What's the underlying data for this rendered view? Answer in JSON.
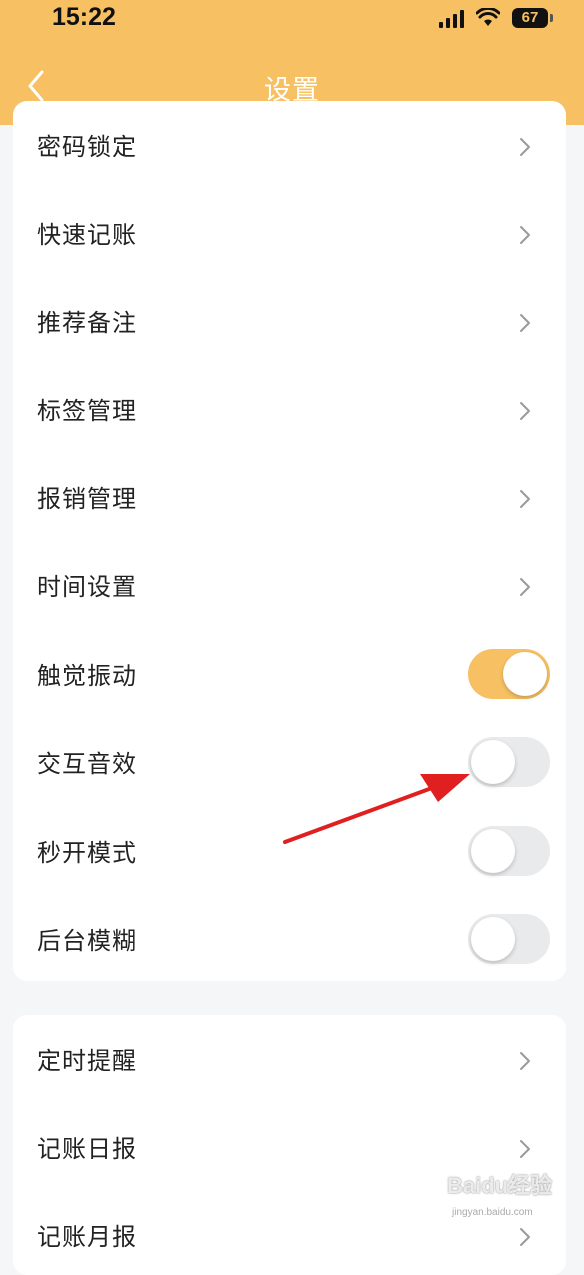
{
  "status_bar": {
    "time": "15:22",
    "battery": "67"
  },
  "header": {
    "title": "设置"
  },
  "group1": [
    {
      "label": "密码锁定",
      "type": "nav"
    },
    {
      "label": "快速记账",
      "type": "nav"
    },
    {
      "label": "推荐备注",
      "type": "nav"
    },
    {
      "label": "标签管理",
      "type": "nav"
    },
    {
      "label": "报销管理",
      "type": "nav"
    },
    {
      "label": "时间设置",
      "type": "nav"
    },
    {
      "label": "触觉振动",
      "type": "toggle",
      "on": true
    },
    {
      "label": "交互音效",
      "type": "toggle",
      "on": false
    },
    {
      "label": "秒开模式",
      "type": "toggle",
      "on": false
    },
    {
      "label": "后台模糊",
      "type": "toggle",
      "on": false
    }
  ],
  "group2": [
    {
      "label": "定时提醒",
      "type": "nav"
    },
    {
      "label": "记账日报",
      "type": "nav"
    },
    {
      "label": "记账月报",
      "type": "nav"
    }
  ],
  "annotation_color": "#e02020",
  "accent_color": "#f7c063",
  "watermark": {
    "text": "Baidu经验",
    "sub": "jingyan.baidu.com"
  }
}
